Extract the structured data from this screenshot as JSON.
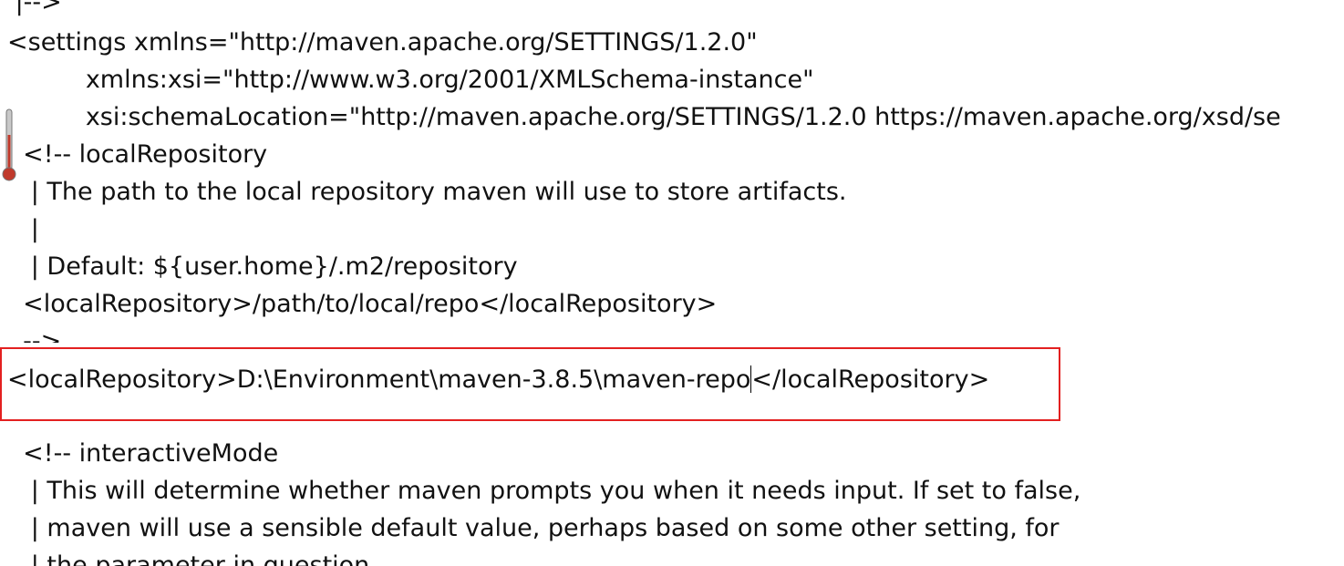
{
  "editor": {
    "lines": [
      " |-->",
      "<settings xmlns=\"http://maven.apache.org/SETTINGS/1.2.0\"",
      "          xmlns:xsi=\"http://www.w3.org/2001/XMLSchema-instance\"",
      "          xsi:schemaLocation=\"http://maven.apache.org/SETTINGS/1.2.0 https://maven.apache.org/xsd/se",
      "  <!-- localRepository",
      "   | The path to the local repository maven will use to store artifacts.",
      "   |",
      "   | Default: ${user.home}/.m2/repository",
      "  <localRepository>/path/to/local/repo</localRepository>",
      "  -->",
      "  <!-- interactiveMode",
      "   | This will determine whether maven prompts you when it needs input. If set to false,",
      "   | maven will use a sensible default value, perhaps based on some other setting, for",
      "   | the parameter in question."
    ],
    "highlighted_line_before_caret": "<localRepository>D:\\Environment\\maven-3.8.5\\maven-repo",
    "highlighted_line_after_caret": "</localRepository>"
  },
  "colors": {
    "highlight_border": "#e32020",
    "text": "#111111",
    "background": "#ffffff"
  },
  "icons": {
    "scroll_indicator": "thermometer-icon"
  }
}
